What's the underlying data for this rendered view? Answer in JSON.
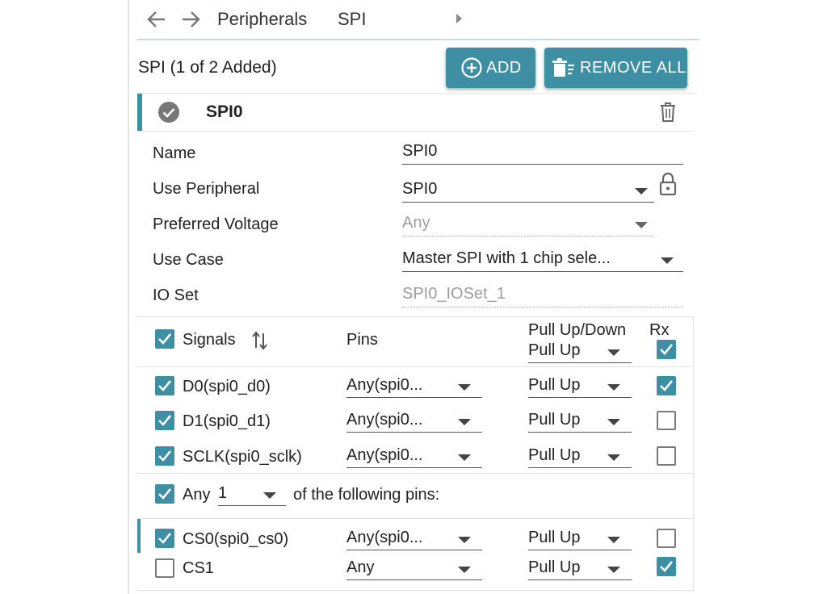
{
  "nav": {
    "crumbs": [
      "Peripherals",
      "SPI"
    ],
    "back_icon": "arrow-left-icon",
    "forward_icon": "arrow-right-icon"
  },
  "section": {
    "title": "SPI (1 of 2 Added)",
    "add_label": "ADD",
    "remove_all_label": "REMOVE ALL"
  },
  "instance": {
    "name": "SPI0",
    "status": "valid"
  },
  "properties": [
    {
      "label": "Name",
      "value": "SPI0",
      "kind": "text",
      "disabled": false
    },
    {
      "label": "Use Peripheral",
      "value": "SPI0",
      "kind": "select",
      "disabled": false,
      "locked": true
    },
    {
      "label": "Preferred Voltage",
      "value": "Any",
      "kind": "select",
      "disabled": true
    },
    {
      "label": "Use Case",
      "value": "Master SPI with 1 chip sele...",
      "kind": "select",
      "disabled": false
    },
    {
      "label": "IO Set",
      "value": "SPI0_IOSet_1",
      "kind": "text",
      "disabled": true
    }
  ],
  "signals_table": {
    "headers": {
      "signals": "Signals",
      "pins": "Pins",
      "pull": "Pull Up/Down",
      "rx": "Rx"
    },
    "header_all_checked": true,
    "header_pull_value": "Pull Up",
    "header_rx_checked": true,
    "rows": [
      {
        "signal": "D0(spi0_d0)",
        "checked": true,
        "pin": "Any(spi0...",
        "pull": "Pull Up",
        "rx": true
      },
      {
        "signal": "D1(spi0_d1)",
        "checked": true,
        "pin": "Any(spi0...",
        "pull": "Pull Up",
        "rx": false
      },
      {
        "signal": "SCLK(spi0_sclk)",
        "checked": true,
        "pin": "Any(spi0...",
        "pull": "Pull Up",
        "rx": false
      }
    ],
    "any_group": {
      "checked": true,
      "prefix": "Any",
      "count": "1",
      "suffix": "of the following pins:"
    },
    "cs_rows": [
      {
        "signal": "CS0(spi0_cs0)",
        "checked": true,
        "pin": "Any(spi0...",
        "pull": "Pull Up",
        "rx": false
      },
      {
        "signal": "CS1",
        "checked": false,
        "pin": "Any",
        "pull": "Pull Up",
        "rx": true
      }
    ]
  },
  "colors": {
    "accent": "#3e8ea4",
    "checkbox_on": "#3e8ea4"
  }
}
